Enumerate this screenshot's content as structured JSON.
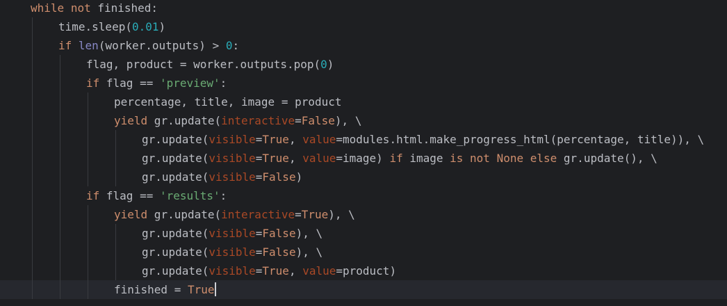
{
  "editor": {
    "theme": {
      "background": "#1e1f22",
      "current_line": "#26282e",
      "keyword": "#cf8e6d",
      "string": "#6aab73",
      "number": "#2aacb8",
      "builtin": "#8888c6",
      "parameter": "#aa4926",
      "default_text": "#bcbec4"
    },
    "lines": [
      {
        "indent": 0,
        "tokens": [
          [
            "kw",
            "while"
          ],
          [
            "t",
            " "
          ],
          [
            "kw",
            "not"
          ],
          [
            "t",
            " finished:"
          ]
        ]
      },
      {
        "indent": 1,
        "tokens": [
          [
            "t",
            "time.sleep("
          ],
          [
            "num",
            "0.01"
          ],
          [
            "t",
            ")"
          ]
        ]
      },
      {
        "indent": 1,
        "tokens": [
          [
            "kw",
            "if"
          ],
          [
            "t",
            " "
          ],
          [
            "builtin",
            "len"
          ],
          [
            "t",
            "(worker.outputs) > "
          ],
          [
            "num",
            "0"
          ],
          [
            "t",
            ":"
          ]
        ]
      },
      {
        "indent": 2,
        "tokens": [
          [
            "t",
            "flag, product = worker.outputs.pop("
          ],
          [
            "num",
            "0"
          ],
          [
            "t",
            ")"
          ]
        ]
      },
      {
        "indent": 2,
        "tokens": [
          [
            "kw",
            "if"
          ],
          [
            "t",
            " flag == "
          ],
          [
            "str",
            "'preview'"
          ],
          [
            "t",
            ":"
          ]
        ]
      },
      {
        "indent": 3,
        "tokens": [
          [
            "t",
            "percentage, title, image = product"
          ]
        ]
      },
      {
        "indent": 3,
        "tokens": [
          [
            "kw",
            "yield"
          ],
          [
            "t",
            " gr.update("
          ],
          [
            "param",
            "interactive"
          ],
          [
            "t",
            "="
          ],
          [
            "kw",
            "False"
          ],
          [
            "t",
            "), \\"
          ]
        ]
      },
      {
        "indent": 4,
        "tokens": [
          [
            "t",
            "gr.update("
          ],
          [
            "param",
            "visible"
          ],
          [
            "t",
            "="
          ],
          [
            "kw",
            "True"
          ],
          [
            "t",
            ", "
          ],
          [
            "param",
            "value"
          ],
          [
            "t",
            "=modules.html.make_progress_html(percentage, title)), \\"
          ]
        ]
      },
      {
        "indent": 4,
        "tokens": [
          [
            "t",
            "gr.update("
          ],
          [
            "param",
            "visible"
          ],
          [
            "t",
            "="
          ],
          [
            "kw",
            "True"
          ],
          [
            "t",
            ", "
          ],
          [
            "param",
            "value"
          ],
          [
            "t",
            "=image) "
          ],
          [
            "kw",
            "if"
          ],
          [
            "t",
            " image "
          ],
          [
            "kw",
            "is not"
          ],
          [
            "t",
            " "
          ],
          [
            "kw",
            "None"
          ],
          [
            "t",
            " "
          ],
          [
            "kw",
            "else"
          ],
          [
            "t",
            " gr.update(), \\"
          ]
        ]
      },
      {
        "indent": 4,
        "tokens": [
          [
            "t",
            "gr.update("
          ],
          [
            "param",
            "visible"
          ],
          [
            "t",
            "="
          ],
          [
            "kw",
            "False"
          ],
          [
            "t",
            ")"
          ]
        ]
      },
      {
        "indent": 2,
        "tokens": [
          [
            "kw",
            "if"
          ],
          [
            "t",
            " flag == "
          ],
          [
            "str",
            "'results'"
          ],
          [
            "t",
            ":"
          ]
        ]
      },
      {
        "indent": 3,
        "tokens": [
          [
            "kw",
            "yield"
          ],
          [
            "t",
            " gr.update("
          ],
          [
            "param",
            "interactive"
          ],
          [
            "t",
            "="
          ],
          [
            "kw",
            "True"
          ],
          [
            "t",
            "), \\"
          ]
        ]
      },
      {
        "indent": 4,
        "tokens": [
          [
            "t",
            "gr.update("
          ],
          [
            "param",
            "visible"
          ],
          [
            "t",
            "="
          ],
          [
            "kw",
            "False"
          ],
          [
            "t",
            "), \\"
          ]
        ]
      },
      {
        "indent": 4,
        "tokens": [
          [
            "t",
            "gr.update("
          ],
          [
            "param",
            "visible"
          ],
          [
            "t",
            "="
          ],
          [
            "kw",
            "False"
          ],
          [
            "t",
            "), \\"
          ]
        ]
      },
      {
        "indent": 4,
        "tokens": [
          [
            "t",
            "gr.update("
          ],
          [
            "param",
            "visible"
          ],
          [
            "t",
            "="
          ],
          [
            "kw",
            "True"
          ],
          [
            "t",
            ", "
          ],
          [
            "param",
            "value"
          ],
          [
            "t",
            "=product)"
          ]
        ]
      },
      {
        "indent": 3,
        "current": true,
        "tokens": [
          [
            "t",
            "finished = "
          ],
          [
            "kw",
            "True"
          ]
        ]
      }
    ]
  }
}
